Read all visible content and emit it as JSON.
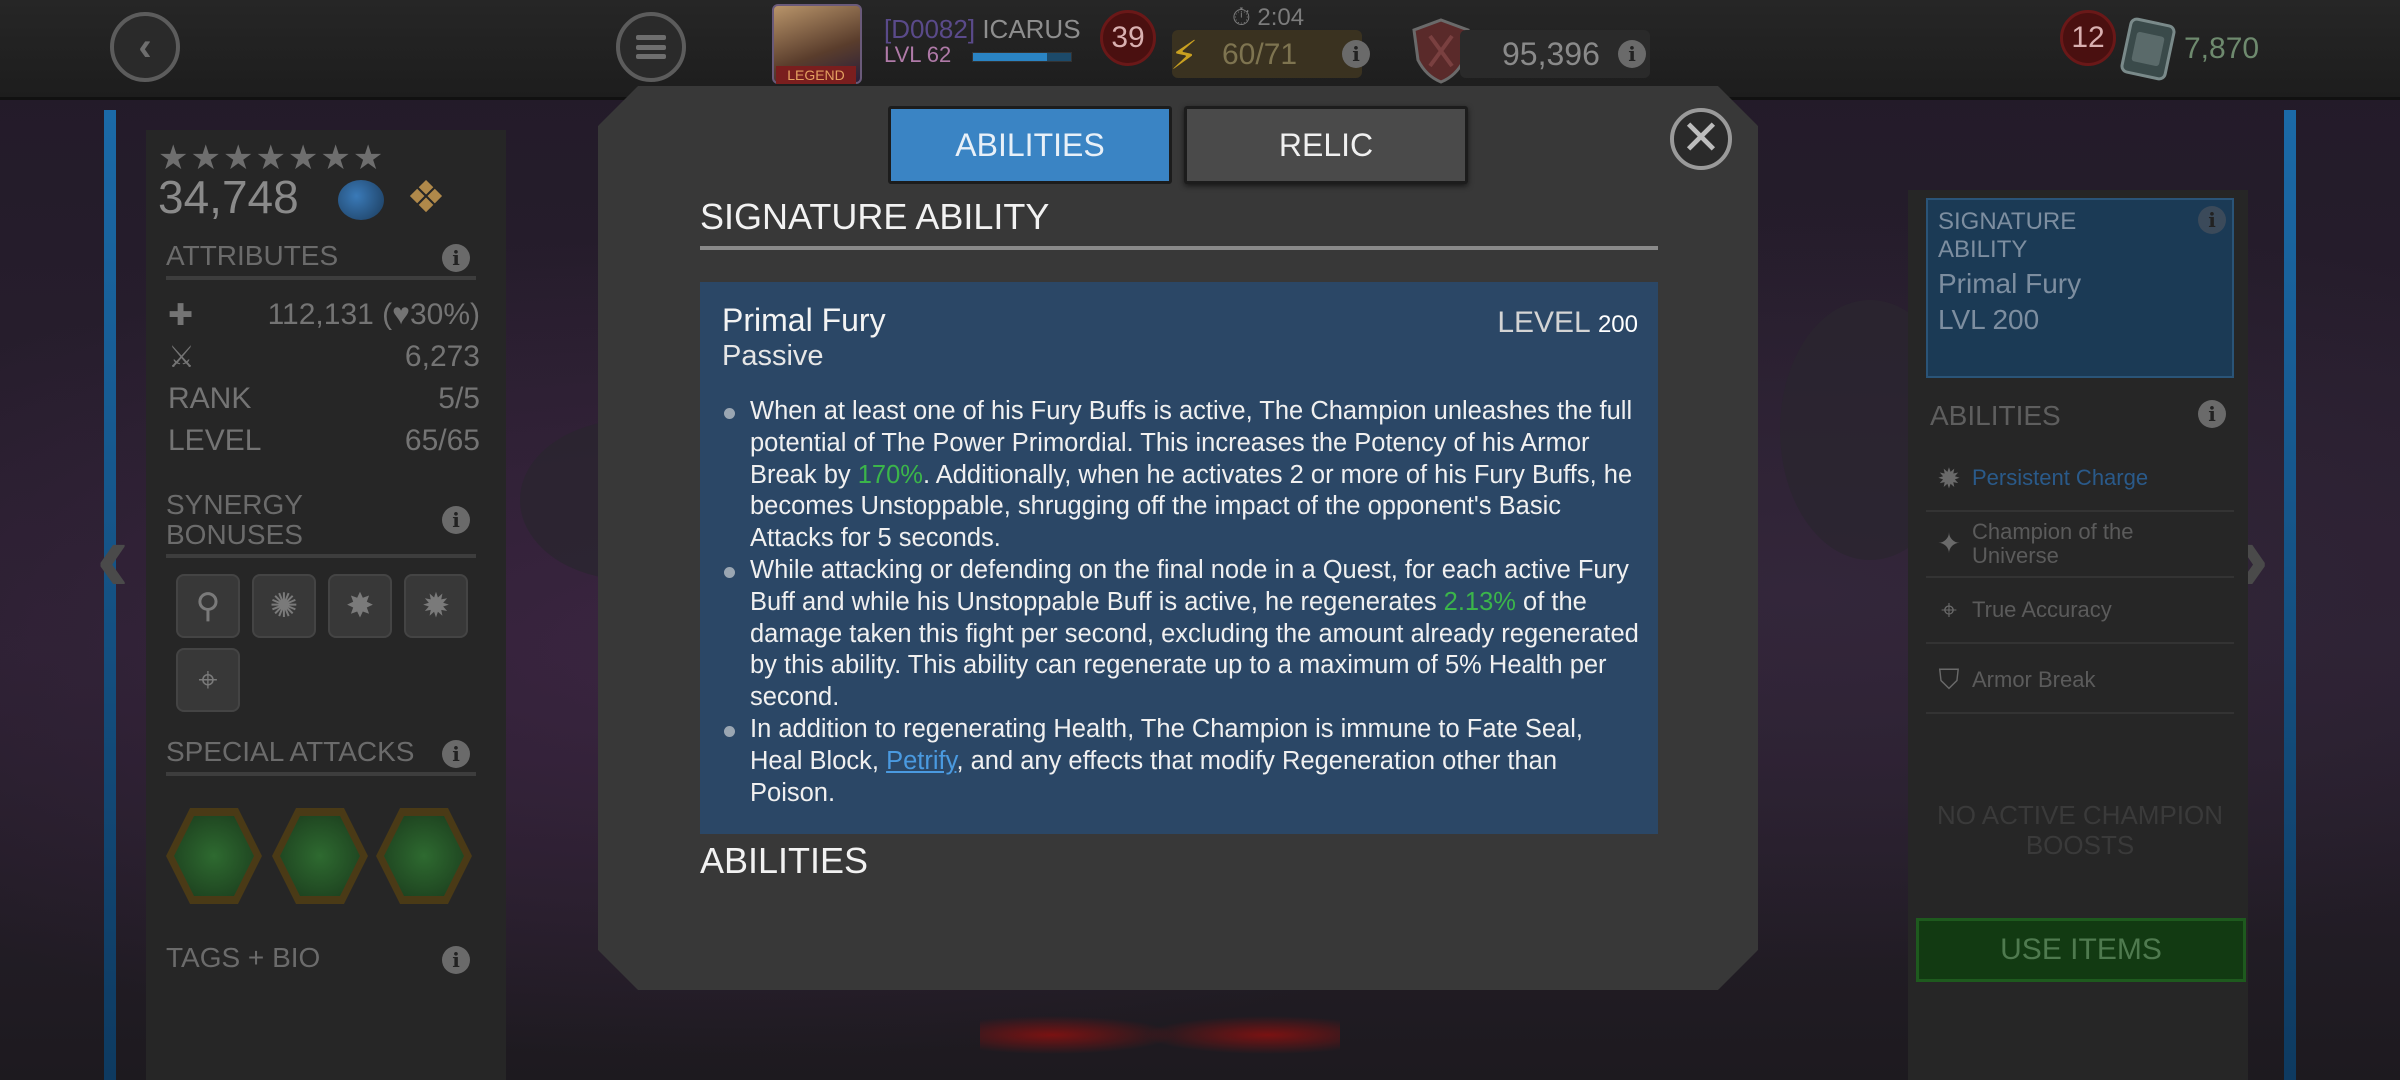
{
  "topbar": {
    "player_tag": "[D0082]",
    "player_name": "ICARUS",
    "player_level": "LVL 62",
    "legend_label": "LEGEND",
    "level_badge": "39",
    "timer": "2:04",
    "energy": "60/71",
    "rating": "95,396",
    "mail_count": "12",
    "units": "7,870",
    "xp_progress": 0.75
  },
  "left_panel": {
    "stars": "★★★★★★★",
    "pi": "34,748",
    "attributes_title": "ATTRIBUTES",
    "health": "112,131 (",
    "health_pct": "30%)",
    "attack": "6,273",
    "rank_label": "RANK",
    "rank_value": "5/5",
    "level_label": "LEVEL",
    "level_value": "65/65",
    "synergy_title_1": "SYNERGY",
    "synergy_title_2": "BONUSES",
    "special_attacks_title": "SPECIAL ATTACKS",
    "tags_bio_title": "TAGS + BIO"
  },
  "right_panel": {
    "sig_card_title": "SIGNATURE ABILITY",
    "sig_card_name": "Primal Fury",
    "sig_card_level": "LVL 200",
    "abilities_title": "ABILITIES",
    "abilities": [
      {
        "label": "Persistent Charge",
        "icon": "burst-icon"
      },
      {
        "label": "Champion of the Universe",
        "icon": "sparkle-icon"
      },
      {
        "label": "True Accuracy",
        "icon": "crosshair-icon"
      },
      {
        "label": "Armor Break",
        "icon": "shield-break-icon"
      }
    ],
    "no_boosts": "NO ACTIVE CHAMPION BOOSTS",
    "use_items": "USE ITEMS"
  },
  "modal": {
    "tab_abilities": "ABILITIES",
    "tab_relic": "RELIC",
    "signature_title": "SIGNATURE ABILITY",
    "ability_name": "Primal Fury",
    "ability_type": "Passive",
    "level_label": "LEVEL",
    "level_value": "200",
    "bullet1_a": "When at least one of his Fury Buffs is active, The Champion unleashes the full potential of The Power Primordial. This increases the Potency of his Armor Break by ",
    "bullet1_pct": "170%",
    "bullet1_b": ". Additionally, when he activates 2 or more of his Fury Buffs, he becomes Unstoppable, shrugging off the impact of the opponent's Basic Attacks for 5 seconds.",
    "bullet2_a": "While attacking or defending on the final node in a Quest, for each active Fury Buff and while his Unstoppable Buff is active, he regenerates ",
    "bullet2_pct": "2.13%",
    "bullet2_b": " of the damage taken this fight per second, excluding the amount already regenerated by this ability. This ability can regenerate up to a maximum of 5% Health per second.",
    "bullet3_a": "In addition to regenerating Health, The Champion is immune to Fate Seal, Heal Block, ",
    "bullet3_link": "Petrify",
    "bullet3_b": ", and any effects that modify Regeneration other than Poison.",
    "abilities_title": "ABILITIES"
  }
}
